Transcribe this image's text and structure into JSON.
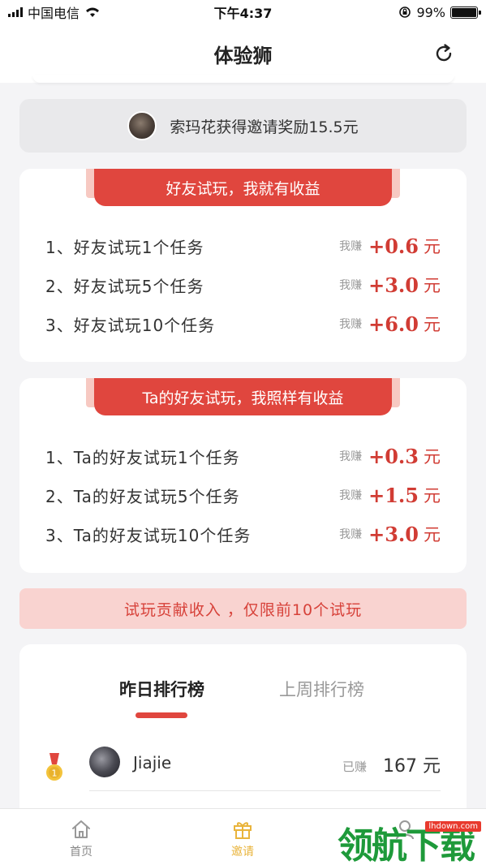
{
  "status_bar": {
    "carrier": "中国电信",
    "time": "下午4:37",
    "battery": "99%"
  },
  "nav": {
    "title": "体验狮"
  },
  "announcement": {
    "text": "索玛花获得邀请奖励15.5元"
  },
  "cards": [
    {
      "title": "好友试玩，我就有收益",
      "rows": [
        {
          "label": "1、好友试玩1个任务",
          "earn_label": "我赚",
          "amount": "+0.6",
          "unit": "元"
        },
        {
          "label": "2、好友试玩5个任务",
          "earn_label": "我赚",
          "amount": "+3.0",
          "unit": "元"
        },
        {
          "label": "3、好友试玩10个任务",
          "earn_label": "我赚",
          "amount": "+6.0",
          "unit": "元"
        }
      ]
    },
    {
      "title": "Ta的好友试玩，我照样有收益",
      "rows": [
        {
          "label": "1、Ta的好友试玩1个任务",
          "earn_label": "我赚",
          "amount": "+0.3",
          "unit": "元"
        },
        {
          "label": "2、Ta的好友试玩5个任务",
          "earn_label": "我赚",
          "amount": "+1.5",
          "unit": "元"
        },
        {
          "label": "3、Ta的好友试玩10个任务",
          "earn_label": "我赚",
          "amount": "+3.0",
          "unit": "元"
        }
      ]
    }
  ],
  "notice": "试玩贡献收入 ，仅限前10个试玩",
  "ranking": {
    "tabs": [
      "昨日排行榜",
      "上周排行榜"
    ],
    "entries": [
      {
        "rank": "1",
        "name": "Jiajie",
        "earned_label": "已赚",
        "amount": "167 元"
      }
    ]
  },
  "tab_bar": {
    "items": [
      {
        "label": "首页",
        "icon": "home-icon"
      },
      {
        "label": "邀请",
        "icon": "gift-icon"
      },
      {
        "label": "",
        "icon": "profile-icon"
      }
    ]
  },
  "watermark": {
    "text": "领航下载",
    "url": "lhdown.com"
  },
  "colors": {
    "accent_red": "#e0463e",
    "amount_red": "#d13c34",
    "active_tab_yellow": "#e9b43c"
  }
}
